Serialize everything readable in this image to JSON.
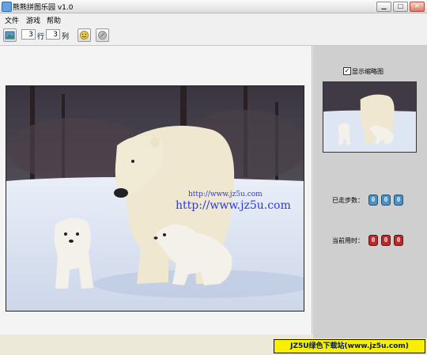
{
  "window": {
    "title": "熊熊拼图乐园 v1.0"
  },
  "menu": [
    "文件",
    "游戏",
    "帮助"
  ],
  "toolbar": {
    "rows_value": "3",
    "rows_label": "行",
    "cols_value": "3",
    "cols_label": "列"
  },
  "side": {
    "show_thumb_label": "显示缩略图",
    "show_thumb_checked": "✓",
    "steps_label": "已走步数：",
    "steps_digits": [
      "0",
      "0",
      "0"
    ],
    "time_label": "当前用时：",
    "time_digits": [
      "0",
      "0",
      "0"
    ]
  },
  "watermark": {
    "small": "http://www.jz5u.com",
    "large": "http://www.jz5u.com"
  },
  "banner": "JZ5U绿色下载站(www.jz5u.com)"
}
